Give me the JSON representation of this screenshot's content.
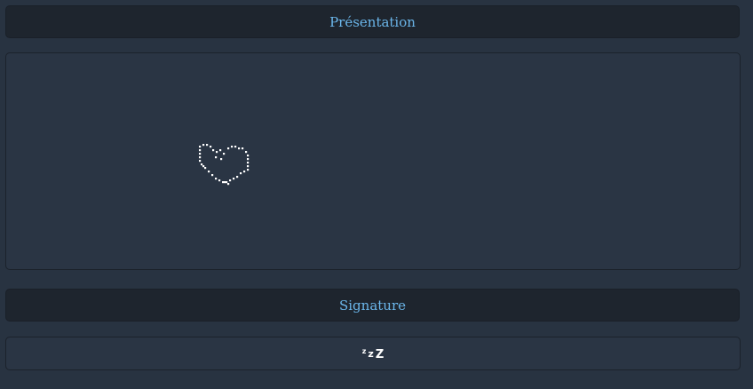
{
  "sections": {
    "presentation": {
      "title": "Présentation"
    },
    "signature": {
      "title": "Signature",
      "text": "ᶻ z 𝗓"
    }
  },
  "colors": {
    "page_background": "#283341",
    "header_background": "#1e252e",
    "panel_background": "#2a3544",
    "title_text": "#6bb6ea",
    "art_dots": "#ffffff"
  },
  "icons": {
    "presentation_art": "dotted-heart-icon",
    "signature_art": "sleeping-zzz-icon"
  }
}
